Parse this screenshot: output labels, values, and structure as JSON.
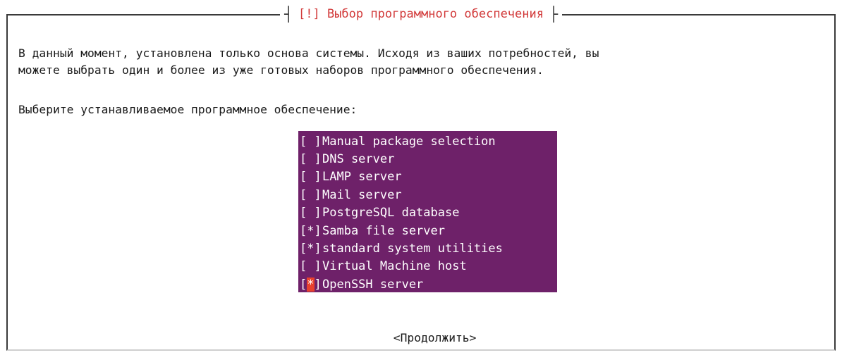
{
  "dialog": {
    "title": "[!] Выбор программного обеспечения",
    "description_line1": "В данный момент, установлена только основа системы. Исходя из ваших потребностей, вы",
    "description_line2": "можете выбрать один и более из уже готовых наборов программного обеспечения.",
    "prompt": "Выберите устанавливаемое программное обеспечение:",
    "continue_label": "<Продолжить>"
  },
  "packages": [
    {
      "label": "Manual package selection",
      "checked": false
    },
    {
      "label": "DNS server",
      "checked": false
    },
    {
      "label": "LAMP server",
      "checked": false
    },
    {
      "label": "Mail server",
      "checked": false
    },
    {
      "label": "PostgreSQL database",
      "checked": false
    },
    {
      "label": "Samba file server",
      "checked": true
    },
    {
      "label": "standard system utilities",
      "checked": true
    },
    {
      "label": "Virtual Machine host",
      "checked": false
    },
    {
      "label": "OpenSSH server",
      "checked": true,
      "focused": true
    }
  ],
  "colors": {
    "list_background": "#6e2169",
    "title_text": "#d23a3a",
    "cursor_highlight": "#e8412e"
  }
}
